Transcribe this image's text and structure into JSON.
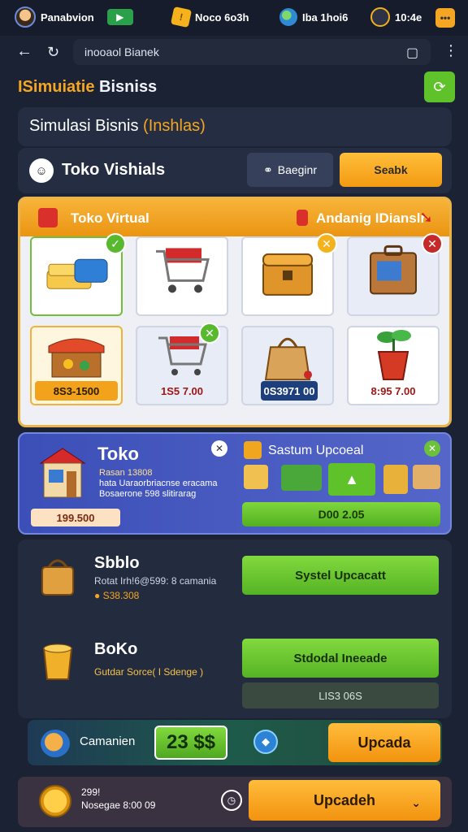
{
  "status": {
    "player_name": "Panabvion",
    "coins": "Noco 6o3h",
    "globe_value": "Iba 1hoi6",
    "time": "10:4e"
  },
  "browser": {
    "url": "inooaol Bianek"
  },
  "page": {
    "title_prefix": "ISimuiatie",
    "title_main": " Bisniss",
    "sim_title_main": "Simulasi Bisnis ",
    "sim_title_accent": "(Inshlas)"
  },
  "store": {
    "name": "Toko Vishials",
    "secondary_button": "Baeginr",
    "primary_button": "Seabk"
  },
  "shop": {
    "left_label": "Toko Virtual",
    "right_label": "Andanig IDianslr",
    "prices": [
      "8S3-1500",
      "1S5 7.00",
      "0S3971 00",
      "8:95 7.00"
    ]
  },
  "toko": {
    "title": "Toko",
    "line1": "Rasan 13808",
    "line2": "hata Uaraorbriacnse eracama",
    "line3": "Bosaerone 598 slitirarag",
    "cost": "199.500",
    "upgrade_title": "Sastum Upcoeal",
    "upgrade_button": "D00 2.05"
  },
  "list": [
    {
      "name": "Sbblo",
      "sub": "Rotat Irh!6@599: 8 camania",
      "sub2": "S38.308",
      "button": "Systel Upcacatt"
    },
    {
      "name": "BoKo",
      "sub": "Gutdar Sorce( I Sdenge )",
      "button": "Stdodal Ineeade",
      "button2": "LIS3 06S"
    }
  ],
  "bottom1": {
    "label": "Camanien",
    "value": "23 $$",
    "button": "Upcada"
  },
  "bottom2": {
    "line1": "299!",
    "line2": "Nosegae 8:00 09",
    "button": "Upcadeh"
  }
}
